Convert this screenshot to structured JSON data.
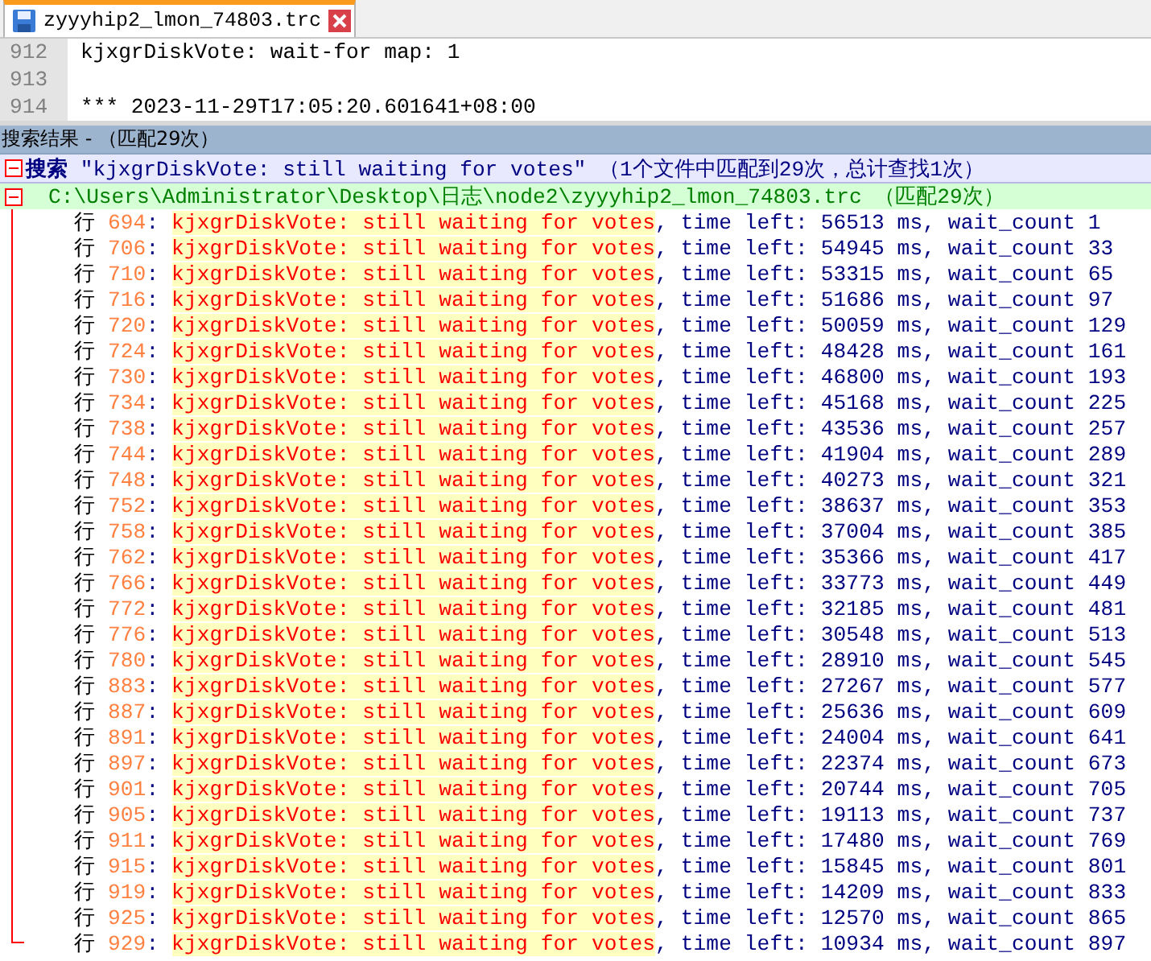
{
  "tab": {
    "title": "zyyyhip2_lmon_74803.trc",
    "selected": true
  },
  "editor": {
    "lines": [
      {
        "number": "912",
        "text": "kjxgrDiskVote: wait-for map: 1"
      },
      {
        "number": "913"
      },
      {
        "number": "914",
        "text": "*** 2023-11-29T17:05:20.601641+08:00"
      }
    ]
  },
  "search_panel": {
    "title": "搜索结果 - （匹配29次）",
    "query": {
      "text": "**搜索** \"kjxgrDiskVote: still waiting for votes\" （1个文件中匹配到29次，总计查找1次）",
      "expanded": true
    },
    "files": [
      {
        "path": "C:\\Users\\Administrator\\Desktop\\日志\\node2\\zyyyhip2_lmon_74803.trc （匹配29次）",
        "expanded": true,
        "results": [
          {
            "label": "行",
            "line": "694",
            "sep": ": ",
            "match": "kjxgrDiskVote: still waiting for votes",
            "rest": ", time left: 56513 ms, wait_count 1"
          },
          {
            "label": "行",
            "line": "706",
            "sep": ": ",
            "match": "kjxgrDiskVote: still waiting for votes",
            "rest": ", time left: 54945 ms, wait_count 33"
          },
          {
            "label": "行",
            "line": "710",
            "sep": ": ",
            "match": "kjxgrDiskVote: still waiting for votes",
            "rest": ", time left: 53315 ms, wait_count 65"
          },
          {
            "label": "行",
            "line": "716",
            "sep": ": ",
            "match": "kjxgrDiskVote: still waiting for votes",
            "rest": ", time left: 51686 ms, wait_count 97"
          },
          {
            "label": "行",
            "line": "720",
            "sep": ": ",
            "match": "kjxgrDiskVote: still waiting for votes",
            "rest": ", time left: 50059 ms, wait_count 129"
          },
          {
            "label": "行",
            "line": "724",
            "sep": ": ",
            "match": "kjxgrDiskVote: still waiting for votes",
            "rest": ", time left: 48428 ms, wait_count 161"
          },
          {
            "label": "行",
            "line": "730",
            "sep": ": ",
            "match": "kjxgrDiskVote: still waiting for votes",
            "rest": ", time left: 46800 ms, wait_count 193"
          },
          {
            "label": "行",
            "line": "734",
            "sep": ": ",
            "match": "kjxgrDiskVote: still waiting for votes",
            "rest": ", time left: 45168 ms, wait_count 225"
          },
          {
            "label": "行",
            "line": "738",
            "sep": ": ",
            "match": "kjxgrDiskVote: still waiting for votes",
            "rest": ", time left: 43536 ms, wait_count 257"
          },
          {
            "label": "行",
            "line": "744",
            "sep": ": ",
            "match": "kjxgrDiskVote: still waiting for votes",
            "rest": ", time left: 41904 ms, wait_count 289"
          },
          {
            "label": "行",
            "line": "748",
            "sep": ": ",
            "match": "kjxgrDiskVote: still waiting for votes",
            "rest": ", time left: 40273 ms, wait_count 321"
          },
          {
            "label": "行",
            "line": "752",
            "sep": ": ",
            "match": "kjxgrDiskVote: still waiting for votes",
            "rest": ", time left: 38637 ms, wait_count 353"
          },
          {
            "label": "行",
            "line": "758",
            "sep": ": ",
            "match": "kjxgrDiskVote: still waiting for votes",
            "rest": ", time left: 37004 ms, wait_count 385"
          },
          {
            "label": "行",
            "line": "762",
            "sep": ": ",
            "match": "kjxgrDiskVote: still waiting for votes",
            "rest": ", time left: 35366 ms, wait_count 417"
          },
          {
            "label": "行",
            "line": "766",
            "sep": ": ",
            "match": "kjxgrDiskVote: still waiting for votes",
            "rest": ", time left: 33773 ms, wait_count 449"
          },
          {
            "label": "行",
            "line": "772",
            "sep": ": ",
            "match": "kjxgrDiskVote: still waiting for votes",
            "rest": ", time left: 32185 ms, wait_count 481"
          },
          {
            "label": "行",
            "line": "776",
            "sep": ": ",
            "match": "kjxgrDiskVote: still waiting for votes",
            "rest": ", time left: 30548 ms, wait_count 513"
          },
          {
            "label": "行",
            "line": "780",
            "sep": ": ",
            "match": "kjxgrDiskVote: still waiting for votes",
            "rest": ", time left: 28910 ms, wait_count 545"
          },
          {
            "label": "行",
            "line": "883",
            "sep": ": ",
            "match": "kjxgrDiskVote: still waiting for votes",
            "rest": ", time left: 27267 ms, wait_count 577"
          },
          {
            "label": "行",
            "line": "887",
            "sep": ": ",
            "match": "kjxgrDiskVote: still waiting for votes",
            "rest": ", time left: 25636 ms, wait_count 609"
          },
          {
            "label": "行",
            "line": "891",
            "sep": ": ",
            "match": "kjxgrDiskVote: still waiting for votes",
            "rest": ", time left: 24004 ms, wait_count 641"
          },
          {
            "label": "行",
            "line": "897",
            "sep": ": ",
            "match": "kjxgrDiskVote: still waiting for votes",
            "rest": ", time left: 22374 ms, wait_count 673"
          },
          {
            "label": "行",
            "line": "901",
            "sep": ": ",
            "match": "kjxgrDiskVote: still waiting for votes",
            "rest": ", time left: 20744 ms, wait_count 705"
          },
          {
            "label": "行",
            "line": "905",
            "sep": ": ",
            "match": "kjxgrDiskVote: still waiting for votes",
            "rest": ", time left: 19113 ms, wait_count 737"
          },
          {
            "label": "行",
            "line": "911",
            "sep": ": ",
            "match": "kjxgrDiskVote: still waiting for votes",
            "rest": ", time left: 17480 ms, wait_count 769"
          },
          {
            "label": "行",
            "line": "915",
            "sep": ": ",
            "match": "kjxgrDiskVote: still waiting for votes",
            "rest": ", time left: 15845 ms, wait_count 801"
          },
          {
            "label": "行",
            "line": "919",
            "sep": ": ",
            "match": "kjxgrDiskVote: still waiting for votes",
            "rest": ", time left: 14209 ms, wait_count 833"
          },
          {
            "label": "行",
            "line": "925",
            "sep": ": ",
            "match": "kjxgrDiskVote: still waiting for votes",
            "rest": ", time left: 12570 ms, wait_count 865"
          },
          {
            "label": "行",
            "line": "929",
            "sep": ": ",
            "match": "kjxgrDiskVote: still waiting for votes",
            "rest": ", time left: 10934 ms, wait_count 897"
          }
        ]
      }
    ]
  }
}
